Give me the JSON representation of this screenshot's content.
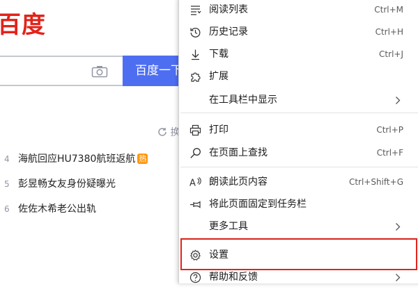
{
  "baidu": {
    "logo": "百度",
    "search_button": "百度一下",
    "refresh_label": "换一换",
    "hot_list": [
      {
        "num": "4",
        "text": "海航回应HU7380航班返航",
        "badge": "热"
      },
      {
        "num": "5",
        "text": "彭昱畅女友身份疑曝光",
        "badge": ""
      },
      {
        "num": "6",
        "text": "佐佐木希老公出轨",
        "badge": ""
      }
    ]
  },
  "menu": {
    "items": [
      {
        "label": "阅读列表",
        "shortcut": "Ctrl+M",
        "icon": "reading-list-icon"
      },
      {
        "label": "历史记录",
        "shortcut": "Ctrl+H",
        "icon": "history-icon"
      },
      {
        "label": "下载",
        "shortcut": "Ctrl+J",
        "icon": "download-icon"
      },
      {
        "label": "扩展",
        "shortcut": "",
        "icon": "extensions-icon"
      },
      {
        "label": "在工具栏中显示",
        "shortcut": "",
        "icon": ""
      },
      {
        "label": "打印",
        "shortcut": "Ctrl+P",
        "icon": "print-icon"
      },
      {
        "label": "在页面上查找",
        "shortcut": "Ctrl+F",
        "icon": "find-icon"
      },
      {
        "label": "朗读此页内容",
        "shortcut": "Ctrl+Shift+G",
        "icon": "read-aloud-icon"
      },
      {
        "label": "将此页面固定到任务栏",
        "shortcut": "",
        "icon": "pin-icon"
      },
      {
        "label": "更多工具",
        "shortcut": "",
        "icon": ""
      },
      {
        "label": "设置",
        "shortcut": "",
        "icon": "gear-icon"
      },
      {
        "label": "帮助和反馈",
        "shortcut": "",
        "icon": "help-icon"
      }
    ]
  },
  "colors": {
    "brand_red": "#e2231a",
    "baidu_blue": "#4e6ef2",
    "highlight": "#e2231a"
  }
}
